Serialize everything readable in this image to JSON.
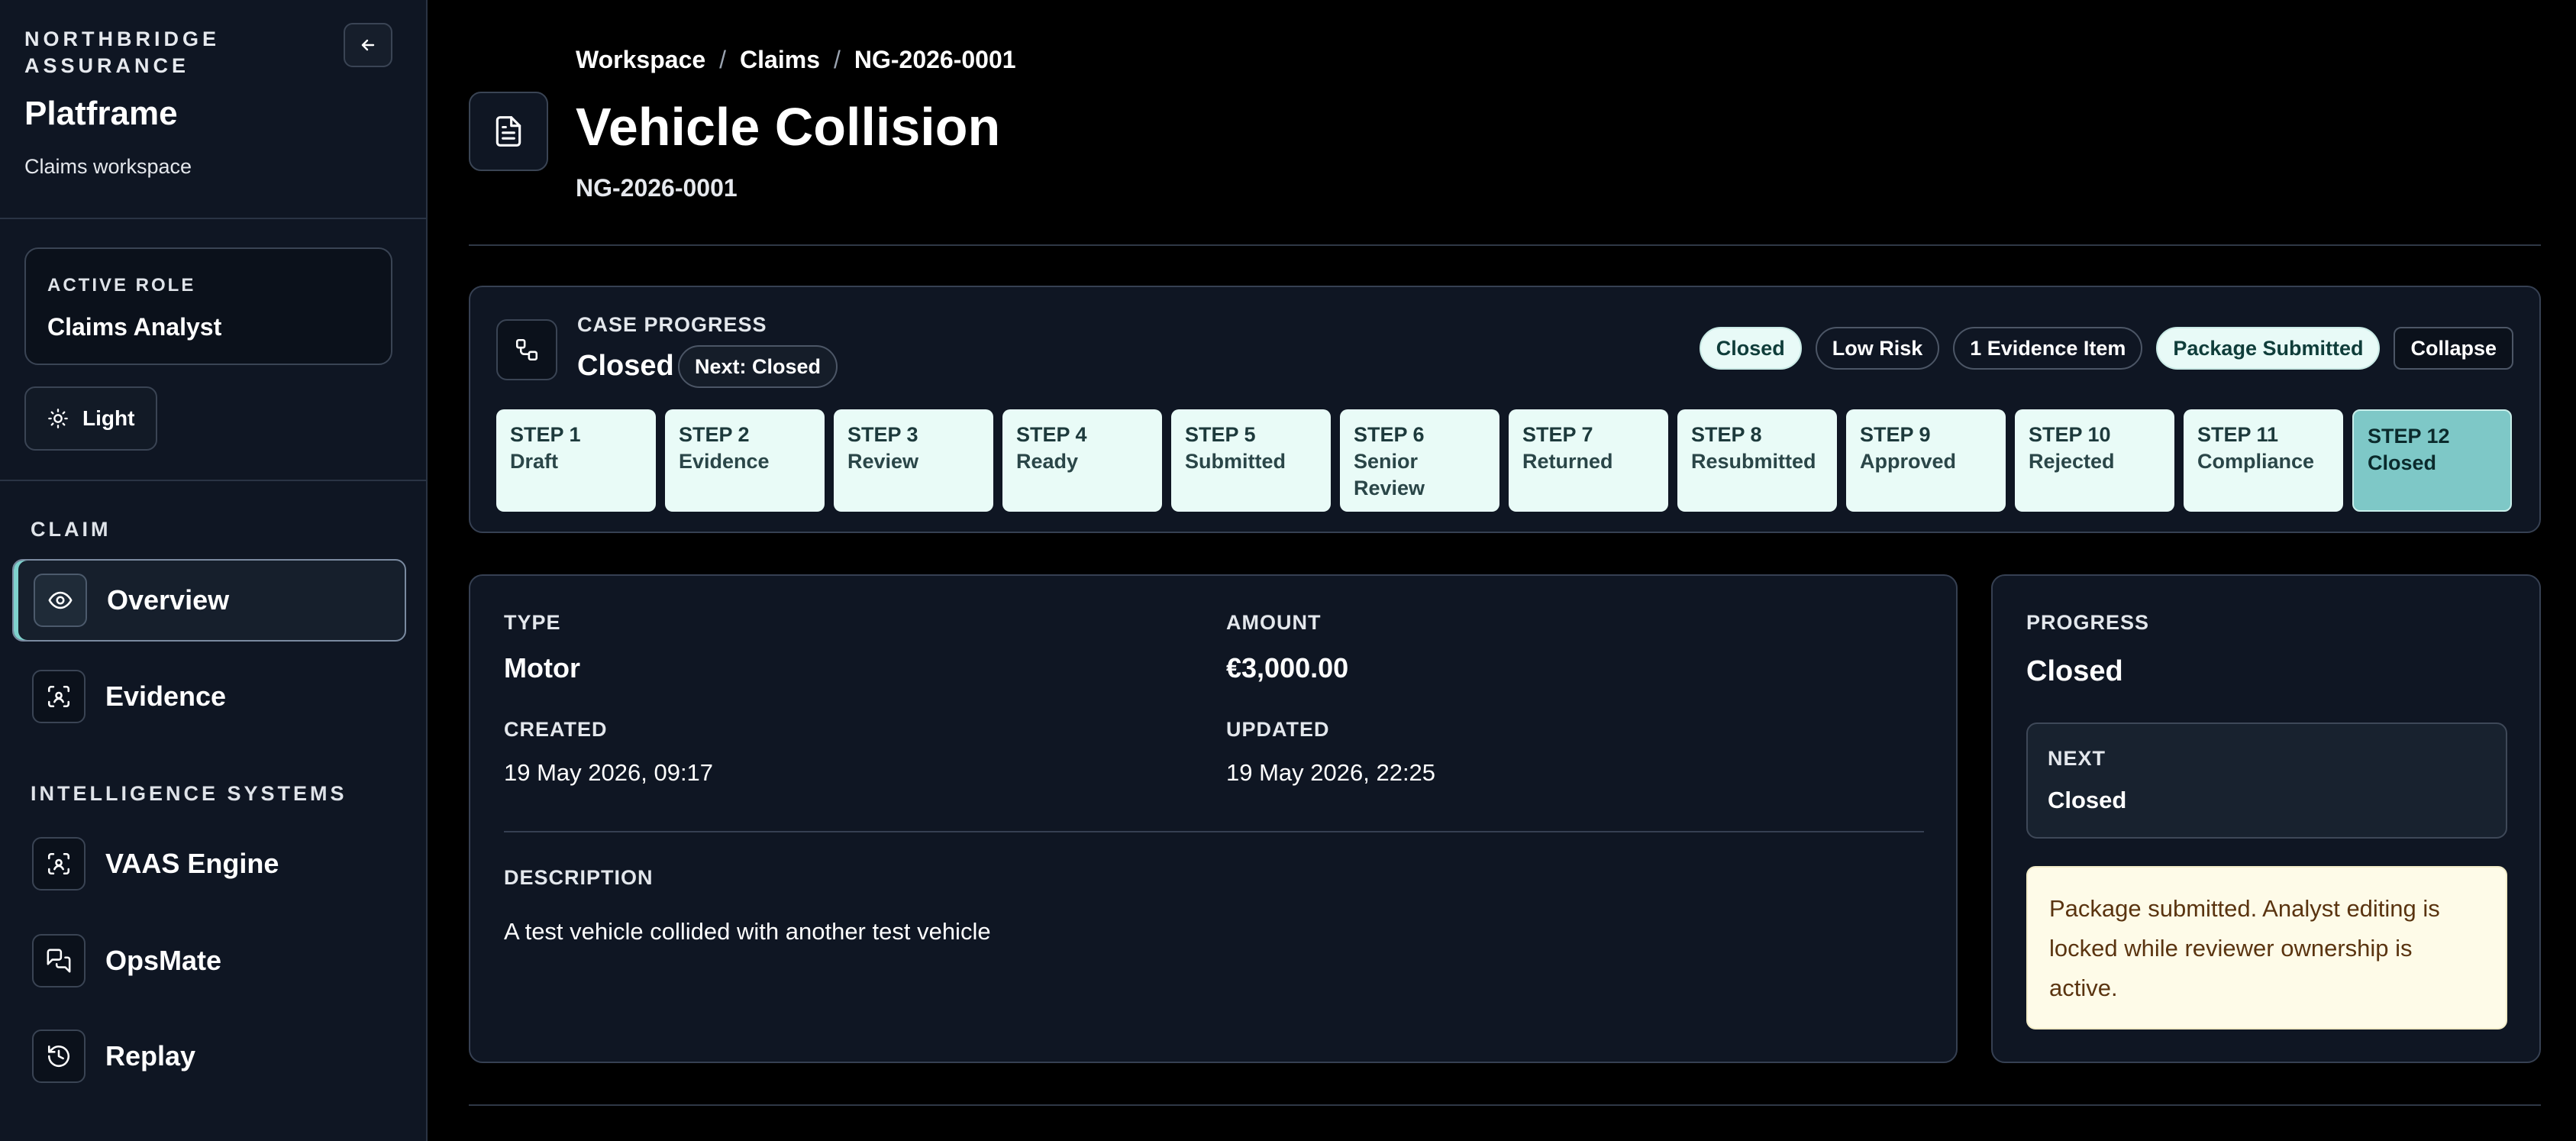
{
  "sidebar": {
    "org": "NORTHBRIDGE ASSURANCE",
    "app_name": "Platframe",
    "app_sub": "Claims workspace",
    "role_caption": "ACTIVE ROLE",
    "role_value": "Claims Analyst",
    "theme_label": "Light",
    "section_claim": "CLAIM",
    "section_intel": "INTELLIGENCE SYSTEMS",
    "nav": [
      {
        "label": "Overview",
        "icon": "eye-icon",
        "active": true
      },
      {
        "label": "Evidence",
        "icon": "scan-icon"
      },
      {
        "label": "VAAS Engine",
        "icon": "scan-icon"
      },
      {
        "label": "OpsMate",
        "icon": "chat-icon"
      },
      {
        "label": "Replay",
        "icon": "history-icon"
      }
    ]
  },
  "header": {
    "breadcrumb": [
      "Workspace",
      "Claims",
      "NG-2026-0001"
    ],
    "separator": "/",
    "title": "Vehicle Collision",
    "subtitle": "NG-2026-0001"
  },
  "progress": {
    "caption": "CASE PROGRESS",
    "status": "Closed",
    "next": "Next: Closed",
    "chips": [
      "Closed",
      "Low Risk",
      "1 Evidence Item",
      "Package Submitted",
      "Collapse"
    ],
    "steps": [
      {
        "num": "STEP 1",
        "name": "Draft"
      },
      {
        "num": "STEP 2",
        "name": "Evidence"
      },
      {
        "num": "STEP 3",
        "name": "Review"
      },
      {
        "num": "STEP 4",
        "name": "Ready"
      },
      {
        "num": "STEP 5",
        "name": "Submitted"
      },
      {
        "num": "STEP 6",
        "name": "Senior Review"
      },
      {
        "num": "STEP 7",
        "name": "Returned"
      },
      {
        "num": "STEP 8",
        "name": "Resubmitted"
      },
      {
        "num": "STEP 9",
        "name": "Approved"
      },
      {
        "num": "STEP 10",
        "name": "Rejected"
      },
      {
        "num": "STEP 11",
        "name": "Compliance"
      },
      {
        "num": "STEP 12",
        "name": "Closed",
        "current": true
      }
    ]
  },
  "details": {
    "type_label": "TYPE",
    "type_value": "Motor",
    "amount_label": "AMOUNT",
    "amount_value": "€3,000.00",
    "created_label": "CREATED",
    "created_value": "19 May 2026, 09:17",
    "updated_label": "UPDATED",
    "updated_value": "19 May 2026, 22:25",
    "description_label": "DESCRIPTION",
    "description_value": "A test vehicle collided with another test vehicle"
  },
  "side_panel": {
    "progress_label": "PROGRESS",
    "progress_value": "Closed",
    "next_label": "NEXT",
    "next_value": "Closed",
    "notice": "Package submitted. Analyst editing is locked while reviewer ownership is active."
  },
  "colors": {
    "background": "#000000",
    "sidebar": "#0f1623",
    "accent_teal": "#7ec8c7",
    "step_bg": "#e9fbf7",
    "notice_bg": "#fefbe8"
  }
}
